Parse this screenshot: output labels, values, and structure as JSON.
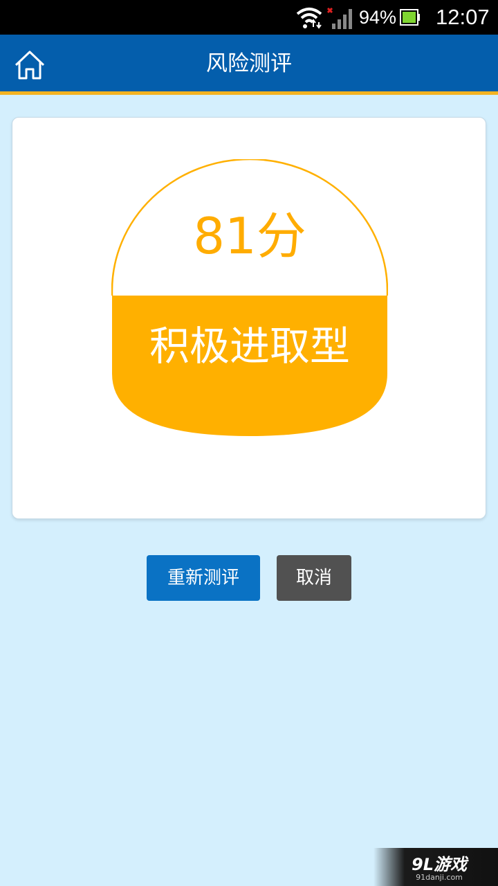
{
  "status_bar": {
    "battery_percent": "94%",
    "time": "12:07",
    "wifi_icon": "wifi-icon",
    "signal_icon": "signal-icon",
    "battery_icon": "battery-icon"
  },
  "header": {
    "title": "风险测评",
    "home_icon": "home-icon",
    "bar_color": "#045eac",
    "accent_color": "#f3b322"
  },
  "result": {
    "score": "81分",
    "risk_type": "积极进取型",
    "accent_color": "#ffac00"
  },
  "actions": {
    "retest_label": "重新测评",
    "cancel_label": "取消"
  },
  "watermark": {
    "logo_text": "9L游戏",
    "url": "91danji.com"
  }
}
